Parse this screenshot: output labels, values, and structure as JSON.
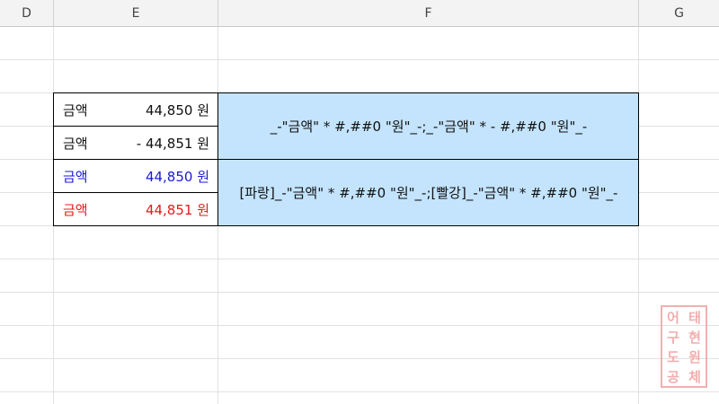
{
  "columns": [
    "D",
    "E",
    "F",
    "G"
  ],
  "rows": [
    {
      "label": "금액",
      "amount": "44,850 원",
      "color": "#111111"
    },
    {
      "label": "금액",
      "amount": "- 44,851 원",
      "color": "#111111"
    },
    {
      "label": "금액",
      "amount": "44,850 원",
      "color": "#1a1ad6"
    },
    {
      "label": "금액",
      "amount": "44,851 원",
      "color": "#e31b1b"
    }
  ],
  "formats": [
    "_-\"금액\" * #,##0 \"원\"_-;_-\"금액\" * - #,##0 \"원\"_-",
    "[파랑]_-\"금액\" * #,##0 \"원\"_-;[빨강]_-\"금액\" * #,##0 \"원\"_-"
  ],
  "seal": {
    "chars": [
      "어",
      "태",
      "구",
      "현",
      "도",
      "원",
      "공",
      "체"
    ]
  }
}
